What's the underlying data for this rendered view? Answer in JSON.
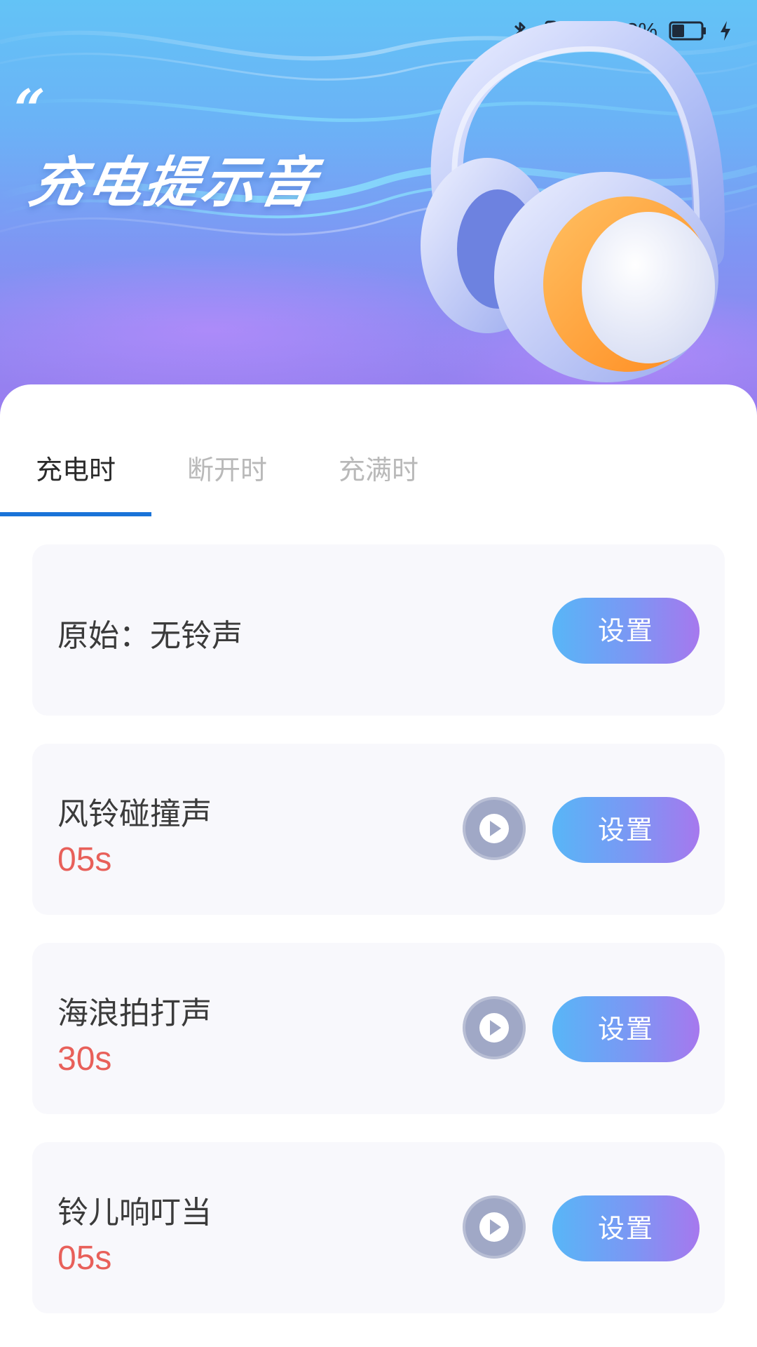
{
  "status_bar": {
    "battery_percent": "43%",
    "battery_level": 0.43,
    "icons": [
      "bluetooth-icon",
      "vibrate-icon",
      "wifi-icon",
      "battery-icon",
      "charging-bolt-icon"
    ]
  },
  "banner": {
    "quote_mark": "“",
    "title": "充电提示音"
  },
  "tabs": [
    {
      "label": "充电时",
      "active": true
    },
    {
      "label": "断开时",
      "active": false
    },
    {
      "label": "充满时",
      "active": false
    }
  ],
  "items": [
    {
      "name": "原始：无铃声",
      "duration": "",
      "button": "设置",
      "has_play": false
    },
    {
      "name": "风铃碰撞声",
      "duration": "05s",
      "button": "设置",
      "has_play": true
    },
    {
      "name": "海浪拍打声",
      "duration": "30s",
      "button": "设置",
      "has_play": true
    },
    {
      "name": "铃儿响叮当",
      "duration": "05s",
      "button": "设置",
      "has_play": true
    }
  ],
  "colors": {
    "tab_active_indicator": "#1a73d8",
    "duration_text": "#e8605a",
    "button_gradient_start": "#58b6f7",
    "button_gradient_end": "#a678ee",
    "play_button": "#a0a8c6",
    "card_background": "#f8f8fc"
  }
}
